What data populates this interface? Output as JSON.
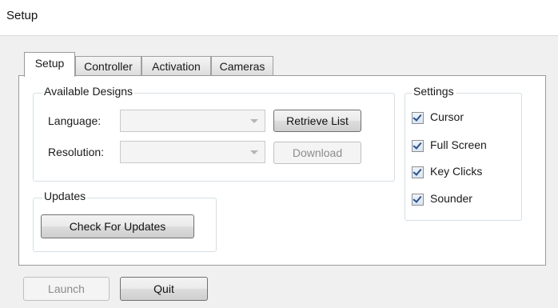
{
  "window": {
    "title": "Setup"
  },
  "tabs": [
    {
      "label": "Setup",
      "active": true
    },
    {
      "label": "Controller",
      "active": false
    },
    {
      "label": "Activation",
      "active": false
    },
    {
      "label": "Cameras",
      "active": false
    }
  ],
  "available_designs": {
    "legend": "Available Designs",
    "language_label": "Language:",
    "language_value": "",
    "resolution_label": "Resolution:",
    "resolution_value": "",
    "retrieve_button": "Retrieve List",
    "download_button": "Download"
  },
  "updates": {
    "legend": "Updates",
    "check_button": "Check For Updates"
  },
  "settings": {
    "legend": "Settings",
    "items": [
      {
        "label": "Cursor",
        "checked": true
      },
      {
        "label": "Full Screen",
        "checked": true
      },
      {
        "label": "Key Clicks",
        "checked": true
      },
      {
        "label": "Sounder",
        "checked": true
      }
    ]
  },
  "footer": {
    "launch_button": "Launch",
    "quit_button": "Quit"
  }
}
